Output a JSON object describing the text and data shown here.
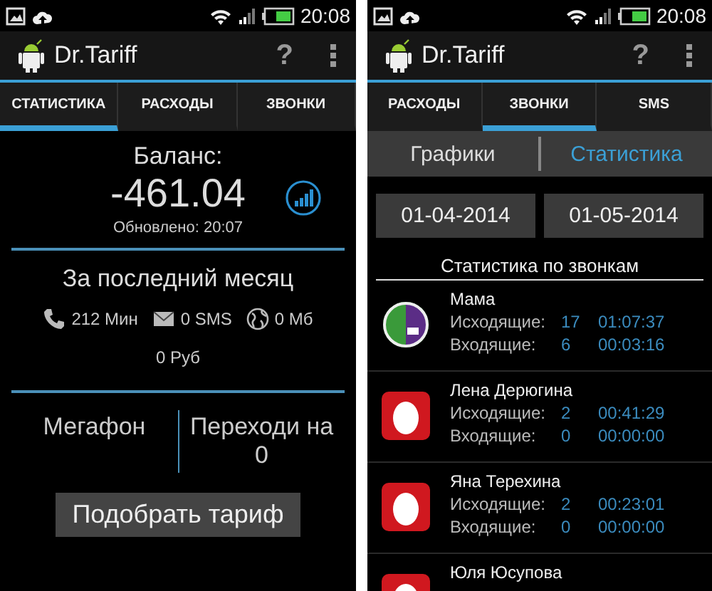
{
  "screens": [
    {
      "status_bar": {
        "time": "20:08"
      },
      "app_bar": {
        "title": "Dr.Tariff",
        "help": "?"
      },
      "tabs": [
        {
          "label": "СТАТИСТИКА",
          "selected": true
        },
        {
          "label": "РАСХОДЫ",
          "selected": false
        },
        {
          "label": "ЗВОНКИ",
          "selected": false
        }
      ],
      "balance": {
        "label": "Баланс:",
        "value": "-461.04",
        "updated": "Обновлено: 20:07"
      },
      "month": {
        "title": "За последний месяц",
        "items": [
          {
            "kind": "calls",
            "text": "212 Мин"
          },
          {
            "kind": "sms",
            "text": "0 SMS"
          },
          {
            "kind": "data",
            "text": "0 Мб"
          }
        ],
        "cost": "0 Руб"
      },
      "operator": {
        "name": "Мегафон",
        "transfers_label": "Переходи на",
        "transfers_value": "0"
      },
      "button": "Подобрать тариф"
    },
    {
      "status_bar": {
        "time": "20:08"
      },
      "app_bar": {
        "title": "Dr.Tariff",
        "help": "?"
      },
      "tabs": [
        {
          "label": "РАСХОДЫ",
          "selected": false
        },
        {
          "label": "ЗВОНКИ",
          "selected": true
        },
        {
          "label": "SMS",
          "selected": false
        }
      ],
      "subtabs": [
        {
          "label": "Графики",
          "selected": false
        },
        {
          "label": "Статистика",
          "selected": true
        }
      ],
      "dates": [
        "01-04-2014",
        "01-05-2014"
      ],
      "heading": "Статистика по звонкам",
      "contacts": [
        {
          "name": "Мама",
          "kind": "megafon",
          "stats": [
            {
              "label": "Исходящие:",
              "count": "17",
              "time": "01:07:37"
            },
            {
              "label": "Входящие:",
              "count": "6",
              "time": "00:03:16"
            }
          ]
        },
        {
          "name": "Лена Дерюгина",
          "kind": "mts",
          "stats": [
            {
              "label": "Исходящие:",
              "count": "2",
              "time": "00:41:29"
            },
            {
              "label": "Входящие:",
              "count": "0",
              "time": "00:00:00"
            }
          ]
        },
        {
          "name": "Яна Терехина",
          "kind": "mts",
          "stats": [
            {
              "label": "Исходящие:",
              "count": "2",
              "time": "00:23:01"
            },
            {
              "label": "Входящие:",
              "count": "0",
              "time": "00:00:00"
            }
          ]
        },
        {
          "name": "Юля Юсупова",
          "kind": "mts"
        }
      ]
    }
  ]
}
